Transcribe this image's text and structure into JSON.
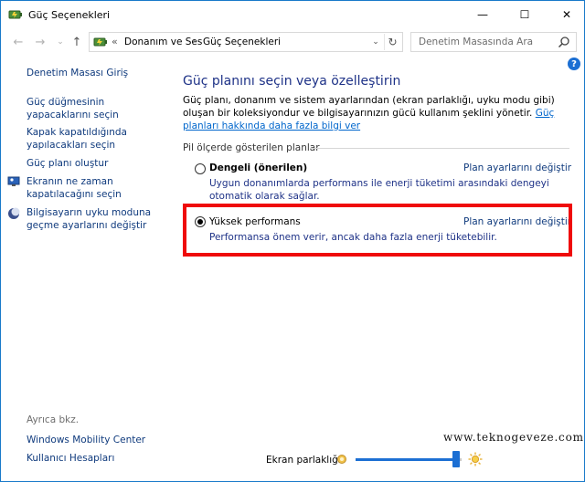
{
  "window": {
    "title": "Güç Seçenekleri"
  },
  "controls": {
    "minimize": "—",
    "maximize": "☐",
    "close": "✕"
  },
  "nav": {
    "back": "←",
    "forward": "→",
    "recent": "⌄",
    "up": "↑",
    "address_prefix": "«",
    "crumbs": [
      "Donanım ve Ses",
      "Güç Seçenekleri"
    ],
    "crumb_separator": "›",
    "dropdown": "⌄",
    "refresh": "↻",
    "search_placeholder": "Denetim Masasında Ara"
  },
  "help": {
    "label": "?"
  },
  "sidebar": {
    "home": "Denetim Masası Giriş",
    "items": [
      "Güç düğmesinin yapacaklarını seçin",
      "Kapak kapatıldığında yapılacakları seçin",
      "Güç planı oluştur",
      "Ekranın ne zaman kapatılacağını seçin",
      "Bilgisayarın uyku moduna geçme ayarlarını değiştir"
    ],
    "see_also_title": "Ayrıca bkz.",
    "see_also": [
      "Windows Mobility Center",
      "Kullanıcı Hesapları"
    ]
  },
  "main": {
    "title": "Güç planını seçin veya özelleştirin",
    "description": "Güç planı, donanım ve sistem ayarlarından (ekran parlaklığı, uyku modu gibi) oluşan bir koleksiyondur ve bilgisayarınızın gücü kullanım şeklini yönetir.",
    "more_link": "Güç planları hakkında daha fazla bilgi ver",
    "group_title": "Pil ölçerde gösterilen planlar",
    "plans": [
      {
        "name": "Dengeli (önerilen)",
        "description": "Uygun donanımlarda performans ile enerji tüketimi arasındaki dengeyi otomatik olarak sağlar.",
        "settings_link": "Plan ayarlarını değiştir",
        "selected": false
      },
      {
        "name": "Yüksek performans",
        "description": "Performansa önem verir, ancak daha fazla enerji tüketebilir.",
        "settings_link": "Plan ayarlarını değiştir",
        "selected": true
      }
    ]
  },
  "watermark": "www.teknogeveze.com",
  "brightness": {
    "label": "Ekran parlaklığı:",
    "value_percent": 95
  },
  "colors": {
    "accent": "#1c6fd3",
    "highlight": "#ef0a0a",
    "link": "#0f3a7d",
    "title": "#1e3287"
  }
}
